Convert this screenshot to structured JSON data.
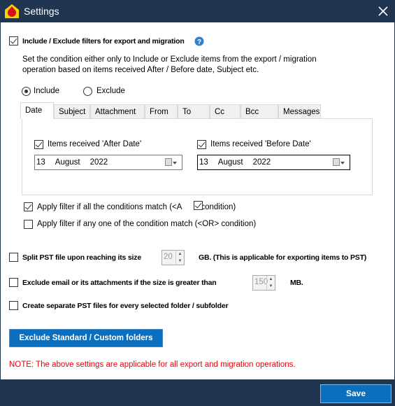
{
  "window": {
    "title": "Settings",
    "close_icon": "close-icon",
    "app_icon": "app-logo-icon"
  },
  "filters": {
    "enabled": true,
    "label": "Include / Exclude filters for export and migration",
    "help_icon": "help-icon",
    "description_line1": "Set the condition either only to Include or Exclude items from the export / migration",
    "description_line2": "operation based on items received After / Before date, Subject etc.",
    "mode_options": [
      {
        "label": "Include",
        "selected": true
      },
      {
        "label": "Exclude",
        "selected": false
      }
    ],
    "tabs": [
      {
        "label": "Date",
        "selected": true
      },
      {
        "label": "Subject"
      },
      {
        "label": "Attachment"
      },
      {
        "label": "From"
      },
      {
        "label": "To"
      },
      {
        "label": "Cc"
      },
      {
        "label": "Bcc"
      },
      {
        "label": "Messages"
      }
    ],
    "after": {
      "checked": true,
      "label": "Items received 'After Date'",
      "day": "13",
      "month": "August",
      "year": "2022"
    },
    "before": {
      "checked": true,
      "label": "Items received 'Before Date'",
      "day": "13",
      "month": "August",
      "year": "2022"
    },
    "match_all": {
      "checked": true,
      "label_start": "Apply filter if all the conditions match (<A",
      "label_end": "> condition)"
    },
    "match_any": {
      "checked": false,
      "label": "Apply filter if any one of the condition match (<OR> condition)"
    }
  },
  "split": {
    "checked": false,
    "label": "Split PST file upon reaching its size",
    "value": "20",
    "suffix": "GB. (This is applicable for exporting items to PST)"
  },
  "exclude_size": {
    "checked": false,
    "label": "Exclude email or its attachments if the size is greater than",
    "value": "150",
    "suffix": "MB."
  },
  "separate": {
    "checked": false,
    "label": "Create separate PST files for every selected folder / subfolder"
  },
  "exclude_folders_button": "Exclude Standard / Custom folders",
  "note": "NOTE: The above settings are applicable for all export and migration operations.",
  "note_color": "#e8000b",
  "save_button": "Save",
  "accent": "#0b6fbd",
  "titlebar_color": "#1f3550"
}
